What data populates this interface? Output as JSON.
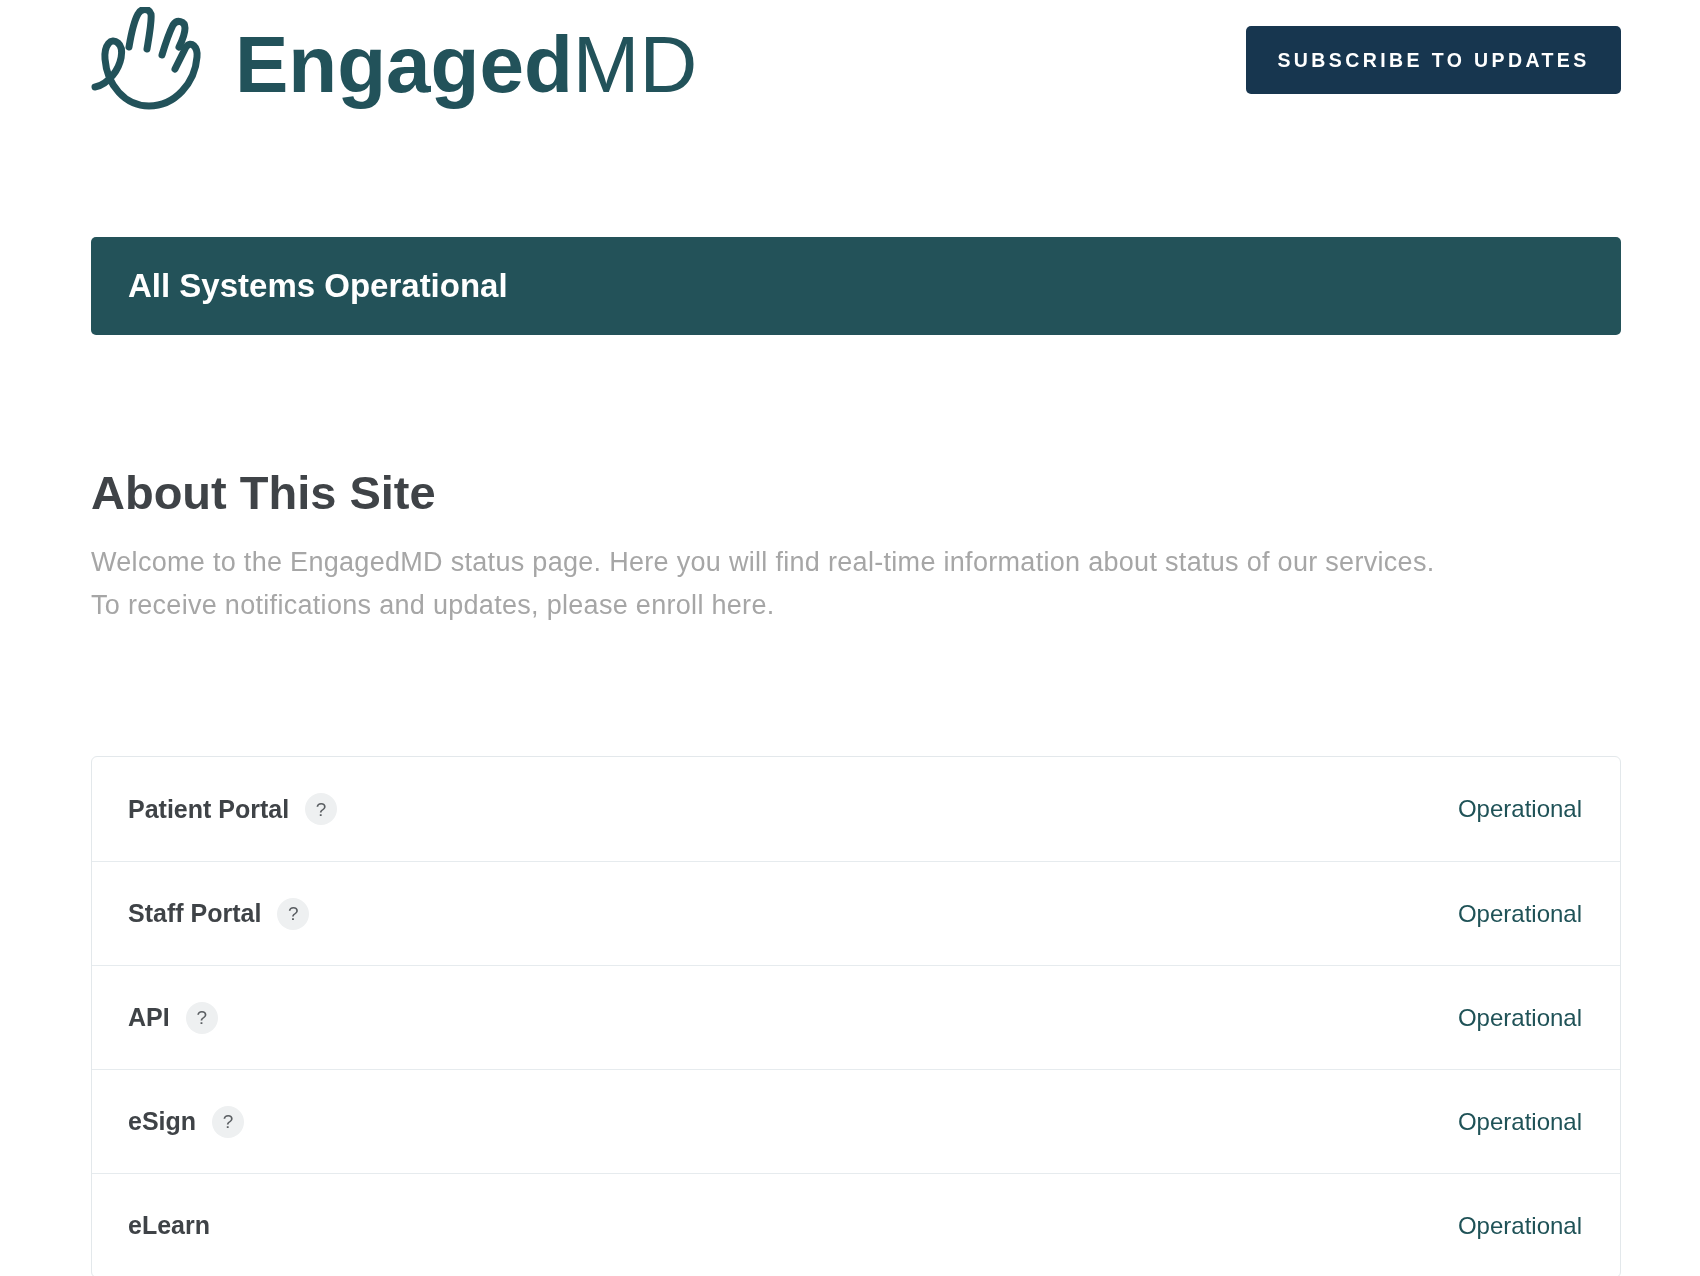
{
  "header": {
    "logo": {
      "wordmark": "**Engaged**MD"
    },
    "subscribe_button": "SUBSCRIBE TO UPDATES"
  },
  "status_banner": {
    "text": "All Systems Operational"
  },
  "about": {
    "title": "About This Site",
    "lines": [
      "Welcome to the EngagedMD status page. Here you will find real-time information about status of our services.",
      "To receive notifications and updates, please enroll here."
    ]
  },
  "components": [
    {
      "name": "Patient Portal",
      "help": "?",
      "status": "Operational"
    },
    {
      "name": "Staff Portal",
      "help": "?",
      "status": "Operational"
    },
    {
      "name": "API",
      "help": "?",
      "status": "Operational"
    },
    {
      "name": "eSign",
      "help": "?",
      "status": "Operational"
    },
    {
      "name": "eLearn",
      "status": "Operational"
    }
  ]
}
